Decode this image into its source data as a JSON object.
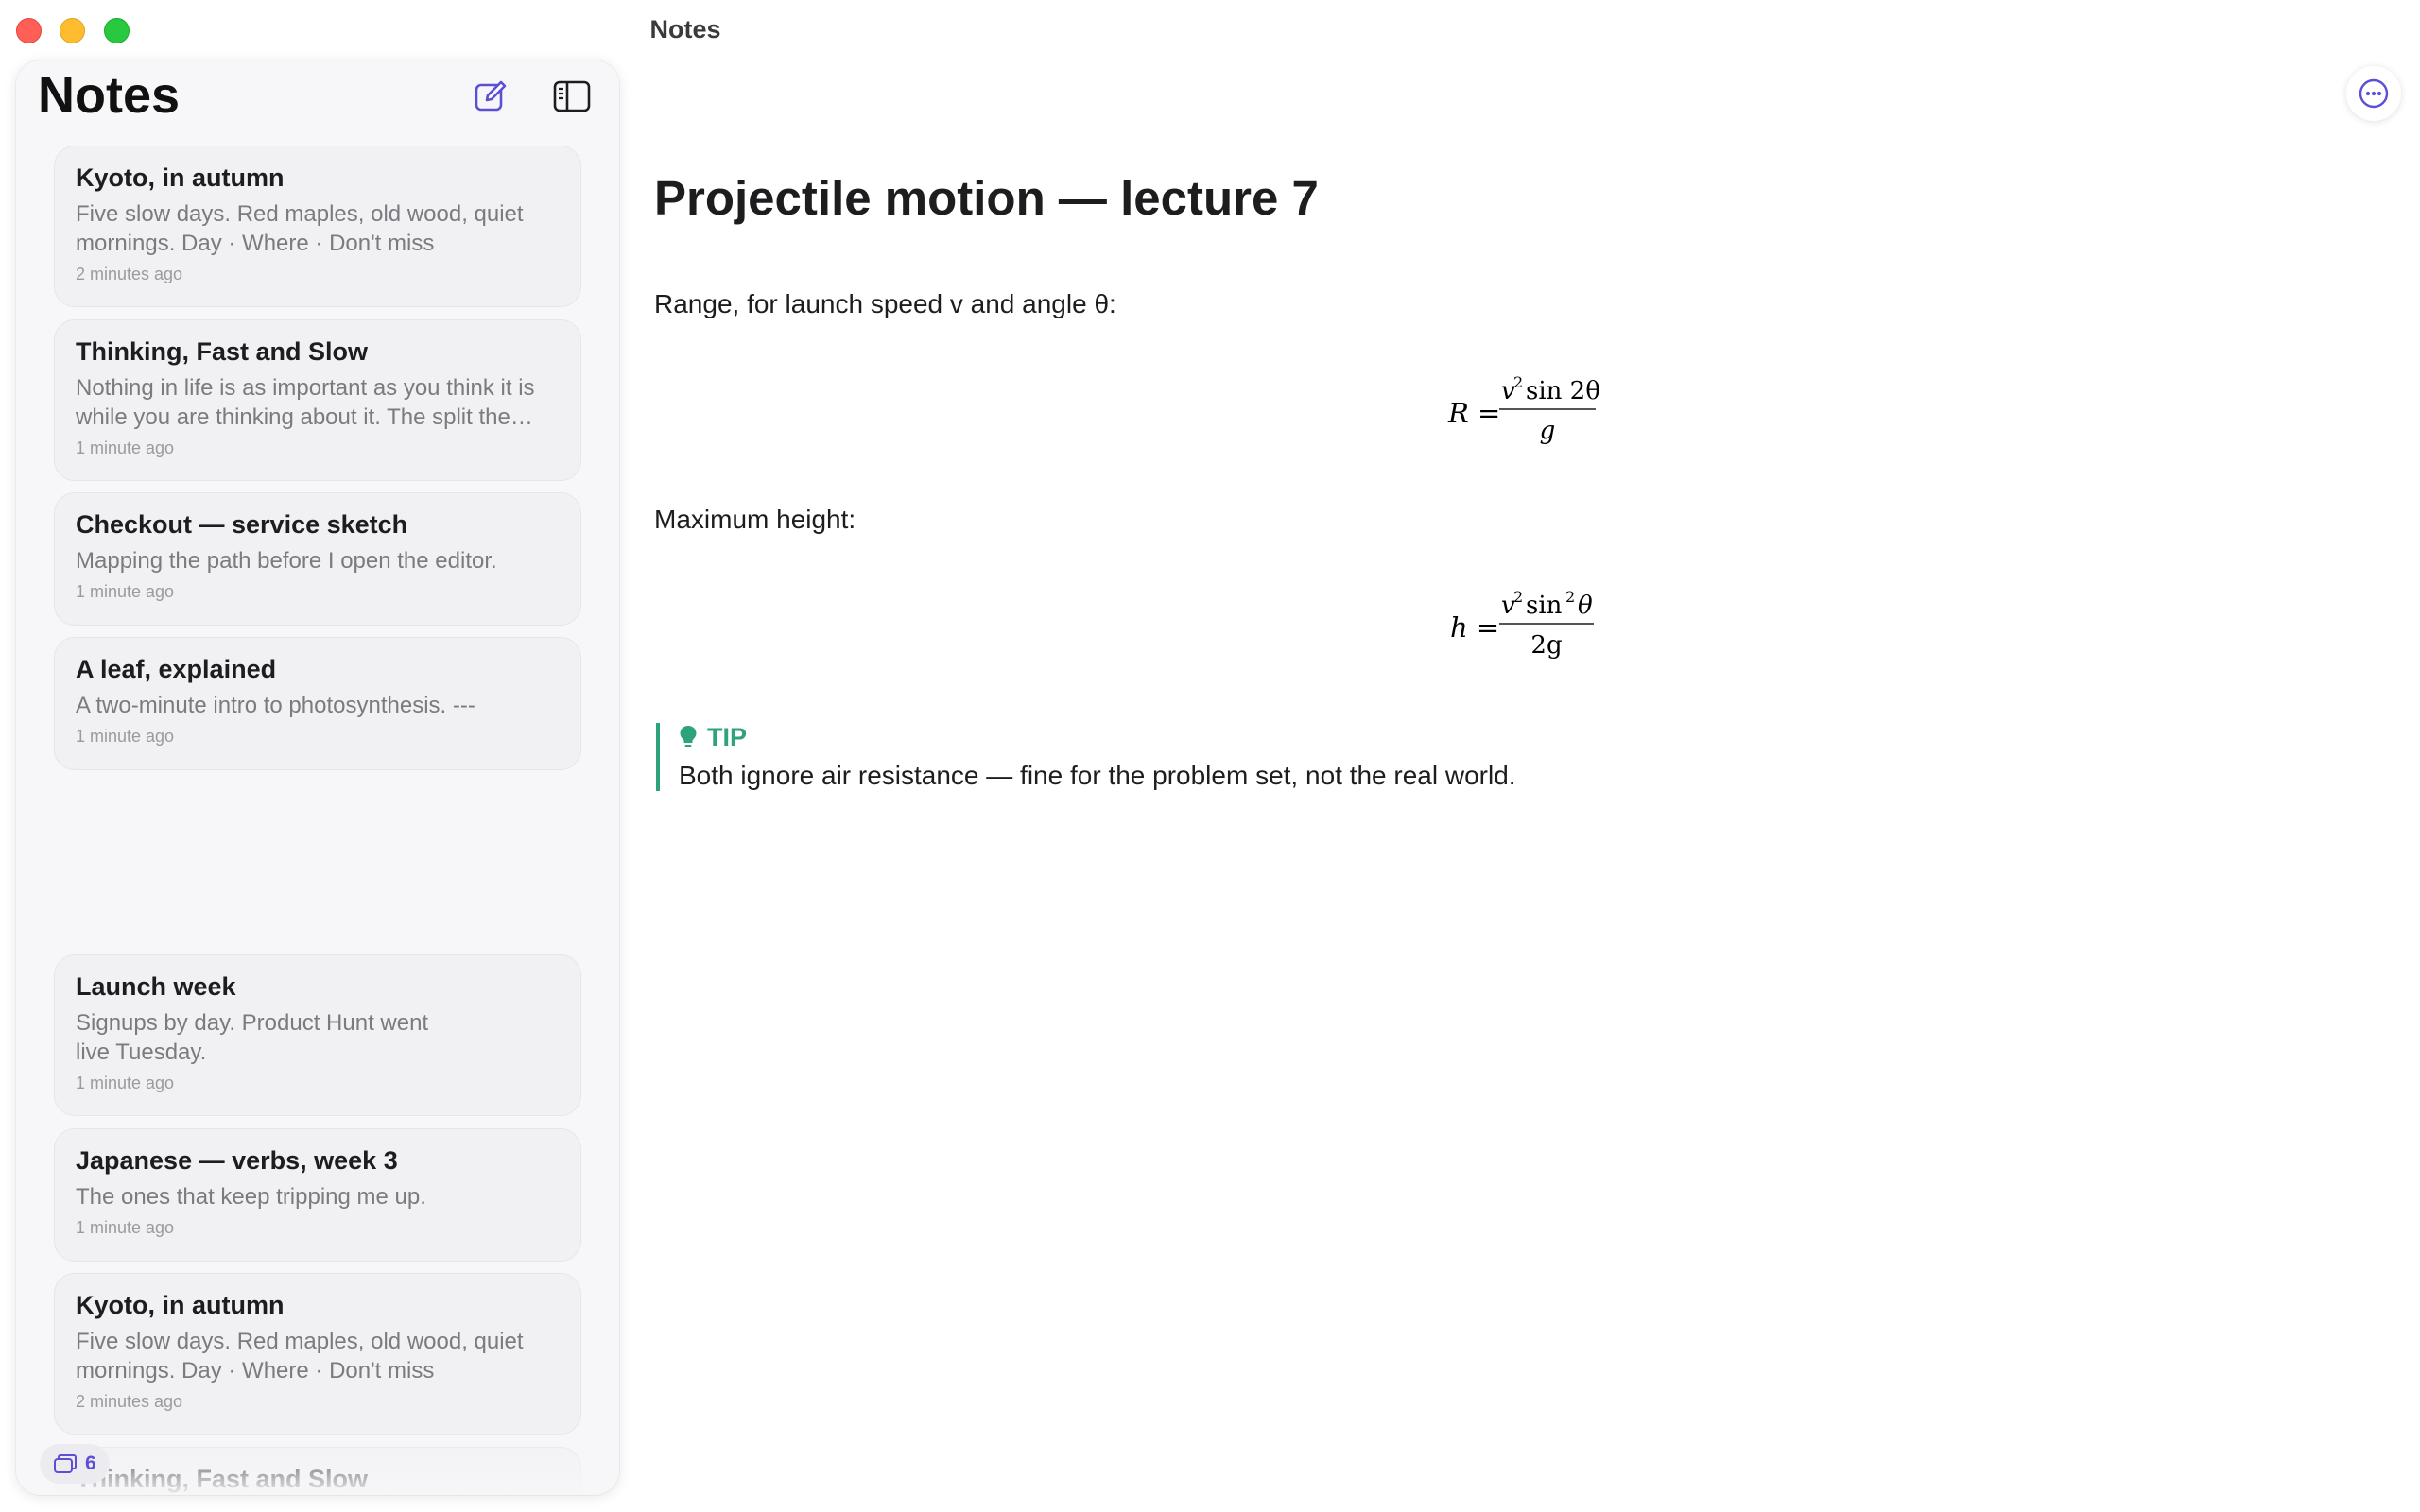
{
  "window": {
    "title": "Notes"
  },
  "sidebar": {
    "title": "Notes",
    "notes": [
      {
        "title": "Kyoto, in autumn",
        "preview": "Five slow days. Red maples, old wood, quiet mornings. Day · Where · Don't miss",
        "time": "2 minutes ago"
      },
      {
        "title": "Thinking, Fast and Slow",
        "preview": "Nothing in life is as important as you think it is while you are thinking about it. The split the…",
        "time": "1 minute ago"
      },
      {
        "title": "Checkout — service sketch",
        "preview": "Mapping the path before I open the editor.",
        "time": "1 minute ago"
      },
      {
        "title": "A leaf, explained",
        "preview": "A two-minute intro to photosynthesis. ---",
        "time": "1 minute ago"
      },
      {
        "title": "Launch week",
        "preview": "Signups by day. Product Hunt went live Tuesday.",
        "time": "1 minute ago"
      },
      {
        "title": "Japanese — verbs, week 3",
        "preview": "The ones that keep tripping me up.",
        "time": "1 minute ago"
      },
      {
        "title": "Kyoto, in autumn",
        "preview": "Five slow days. Red maples, old wood, quiet mornings. Day · Where · Don't miss",
        "time": "2 minutes ago"
      },
      {
        "title": "Thinking, Fast and Slow",
        "preview": "",
        "time": ""
      }
    ],
    "count": "6"
  },
  "document": {
    "title": "Projectile motion — lecture 7",
    "p1": "Range, for launch speed v and angle θ:",
    "formula1": {
      "lhs": "R =",
      "num_v": "v",
      "num_exp": "2",
      "num_rest": "sin 2θ",
      "den": "g"
    },
    "p2": "Maximum height:",
    "formula2": {
      "lhs": "h =",
      "num_v": "v",
      "num_exp": "2",
      "num_sin": "sin",
      "num_sin_exp": "2",
      "num_rest": "θ",
      "den": "2g"
    },
    "callout": {
      "label": "TIP",
      "text": "Both ignore air resistance — fine for the problem set, not the real world."
    }
  },
  "colors": {
    "accent": "#5b4fd6",
    "tip": "#2ea37a"
  }
}
